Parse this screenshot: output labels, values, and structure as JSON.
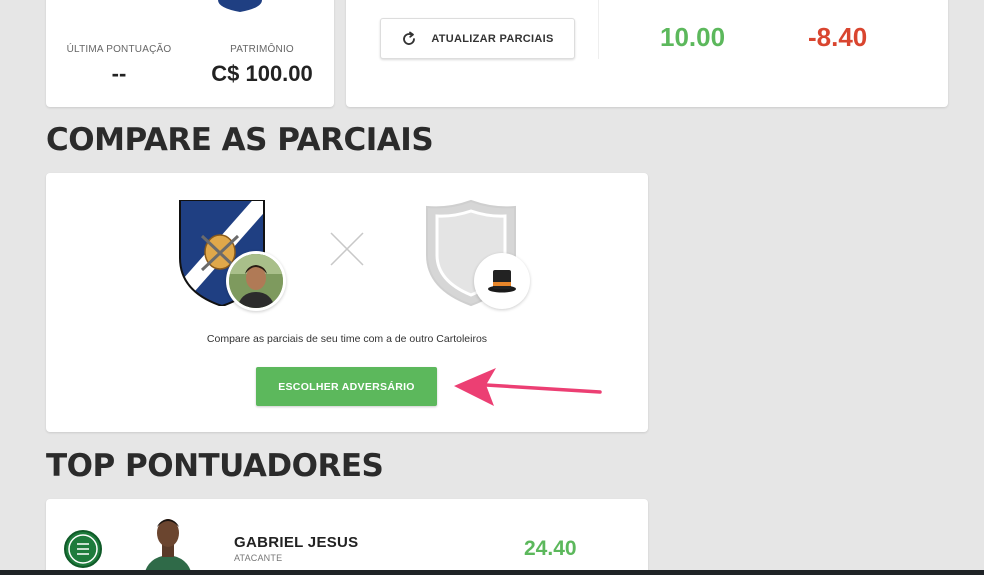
{
  "summary": {
    "last_score_label": "ÚLTIMA PONTUAÇÃO",
    "last_score_value": "--",
    "patrimonio_label": "PATRIMÔNIO",
    "patrimonio_value": "C$ 100.00"
  },
  "partials": {
    "update_button_label": "ATUALIZAR PARCIAIS",
    "score_positive": "10.00",
    "score_negative": "-8.40"
  },
  "compare": {
    "section_title": "COMPARE AS PARCIAIS",
    "description": "Compare as parciais de seu time com a de outro Cartoleiros",
    "choose_button_label": "ESCOLHER ADVERSÁRIO"
  },
  "top_scorers": {
    "section_title": "TOP PONTUADORES",
    "players": [
      {
        "name": "GABRIEL JESUS",
        "position": "ATACANTE",
        "score": "24.40"
      }
    ]
  },
  "colors": {
    "green": "#5cb85c",
    "red": "#d9452f",
    "arrow_pink": "#ec3f73",
    "shield_blue": "#1f3f82"
  },
  "icons": [
    "shield-icon",
    "refresh-icon",
    "versus-icon",
    "top-hat-icon",
    "arrow-icon",
    "club-badge-icon"
  ]
}
